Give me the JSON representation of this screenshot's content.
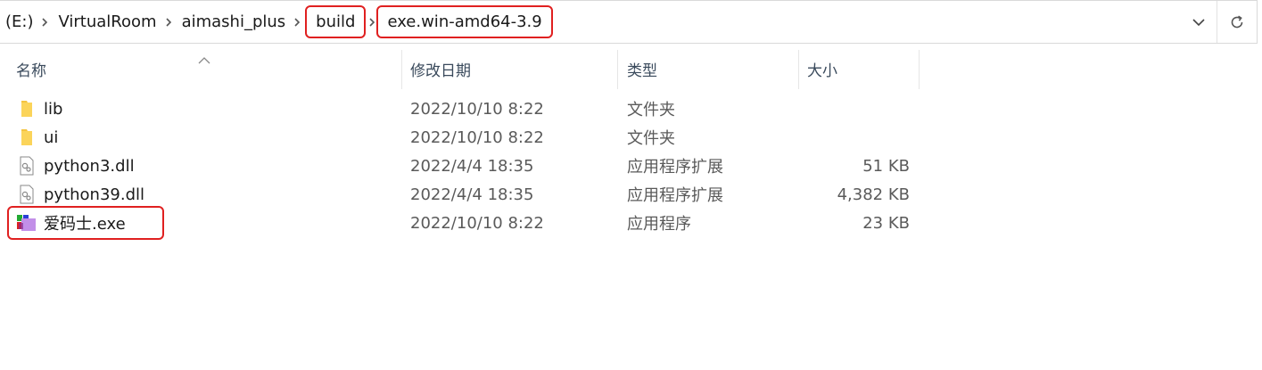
{
  "address_bar": {
    "crumbs": [
      "(E:)",
      "VirtualRoom",
      "aimashi_plus",
      "build",
      "exe.win-amd64-3.9"
    ]
  },
  "columns": {
    "name": "名称",
    "date": "修改日期",
    "type": "类型",
    "size": "大小"
  },
  "files": [
    {
      "name": "lib",
      "date": "2022/10/10 8:22",
      "type": "文件夹",
      "size": "",
      "icon": "folder-icon"
    },
    {
      "name": "ui",
      "date": "2022/10/10 8:22",
      "type": "文件夹",
      "size": "",
      "icon": "folder-icon"
    },
    {
      "name": "python3.dll",
      "date": "2022/4/4 18:35",
      "type": "应用程序扩展",
      "size": "51 KB",
      "icon": "dll-file-icon"
    },
    {
      "name": "python39.dll",
      "date": "2022/4/4 18:35",
      "type": "应用程序扩展",
      "size": "4,382 KB",
      "icon": "dll-file-icon"
    },
    {
      "name": "爱码士.exe",
      "date": "2022/10/10 8:22",
      "type": "应用程序",
      "size": "23 KB",
      "icon": "app-exe-icon"
    }
  ],
  "colors": {
    "highlight": "#e02020",
    "folder": "#f4c441"
  }
}
